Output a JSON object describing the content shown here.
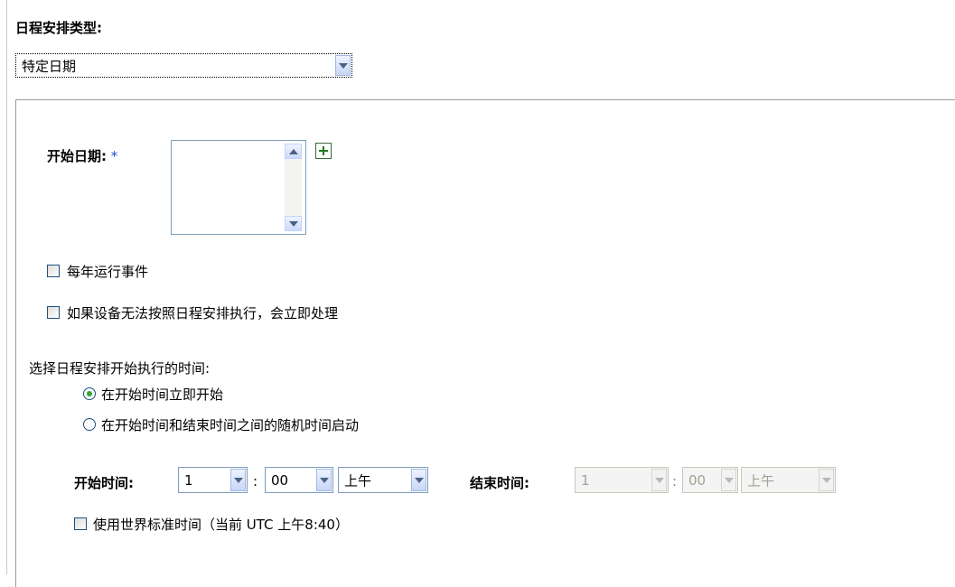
{
  "schedule_type": {
    "label": "日程安排类型:",
    "selected": "特定日期"
  },
  "start_date": {
    "label": "开始日期:",
    "required_marker": "*"
  },
  "options": {
    "run_yearly": "每年运行事件",
    "run_immediately_if_missed": "如果设备无法按照日程安排执行，会立即处理"
  },
  "execution": {
    "label": "选择日程安排开始执行的时间:",
    "radio_start_immediately": "在开始时间立即开始",
    "radio_random": "在开始时间和结束时间之间的随机时间启动"
  },
  "time": {
    "start_label": "开始时间:",
    "start_hour": "1",
    "start_minute": "00",
    "start_ampm": "上午",
    "separator": ":",
    "end_label": "结束时间:",
    "end_hour": "1",
    "end_minute": "00",
    "end_ampm": "上午",
    "utc_label": "使用世界标准时间（当前 UTC 上午8:40）"
  }
}
